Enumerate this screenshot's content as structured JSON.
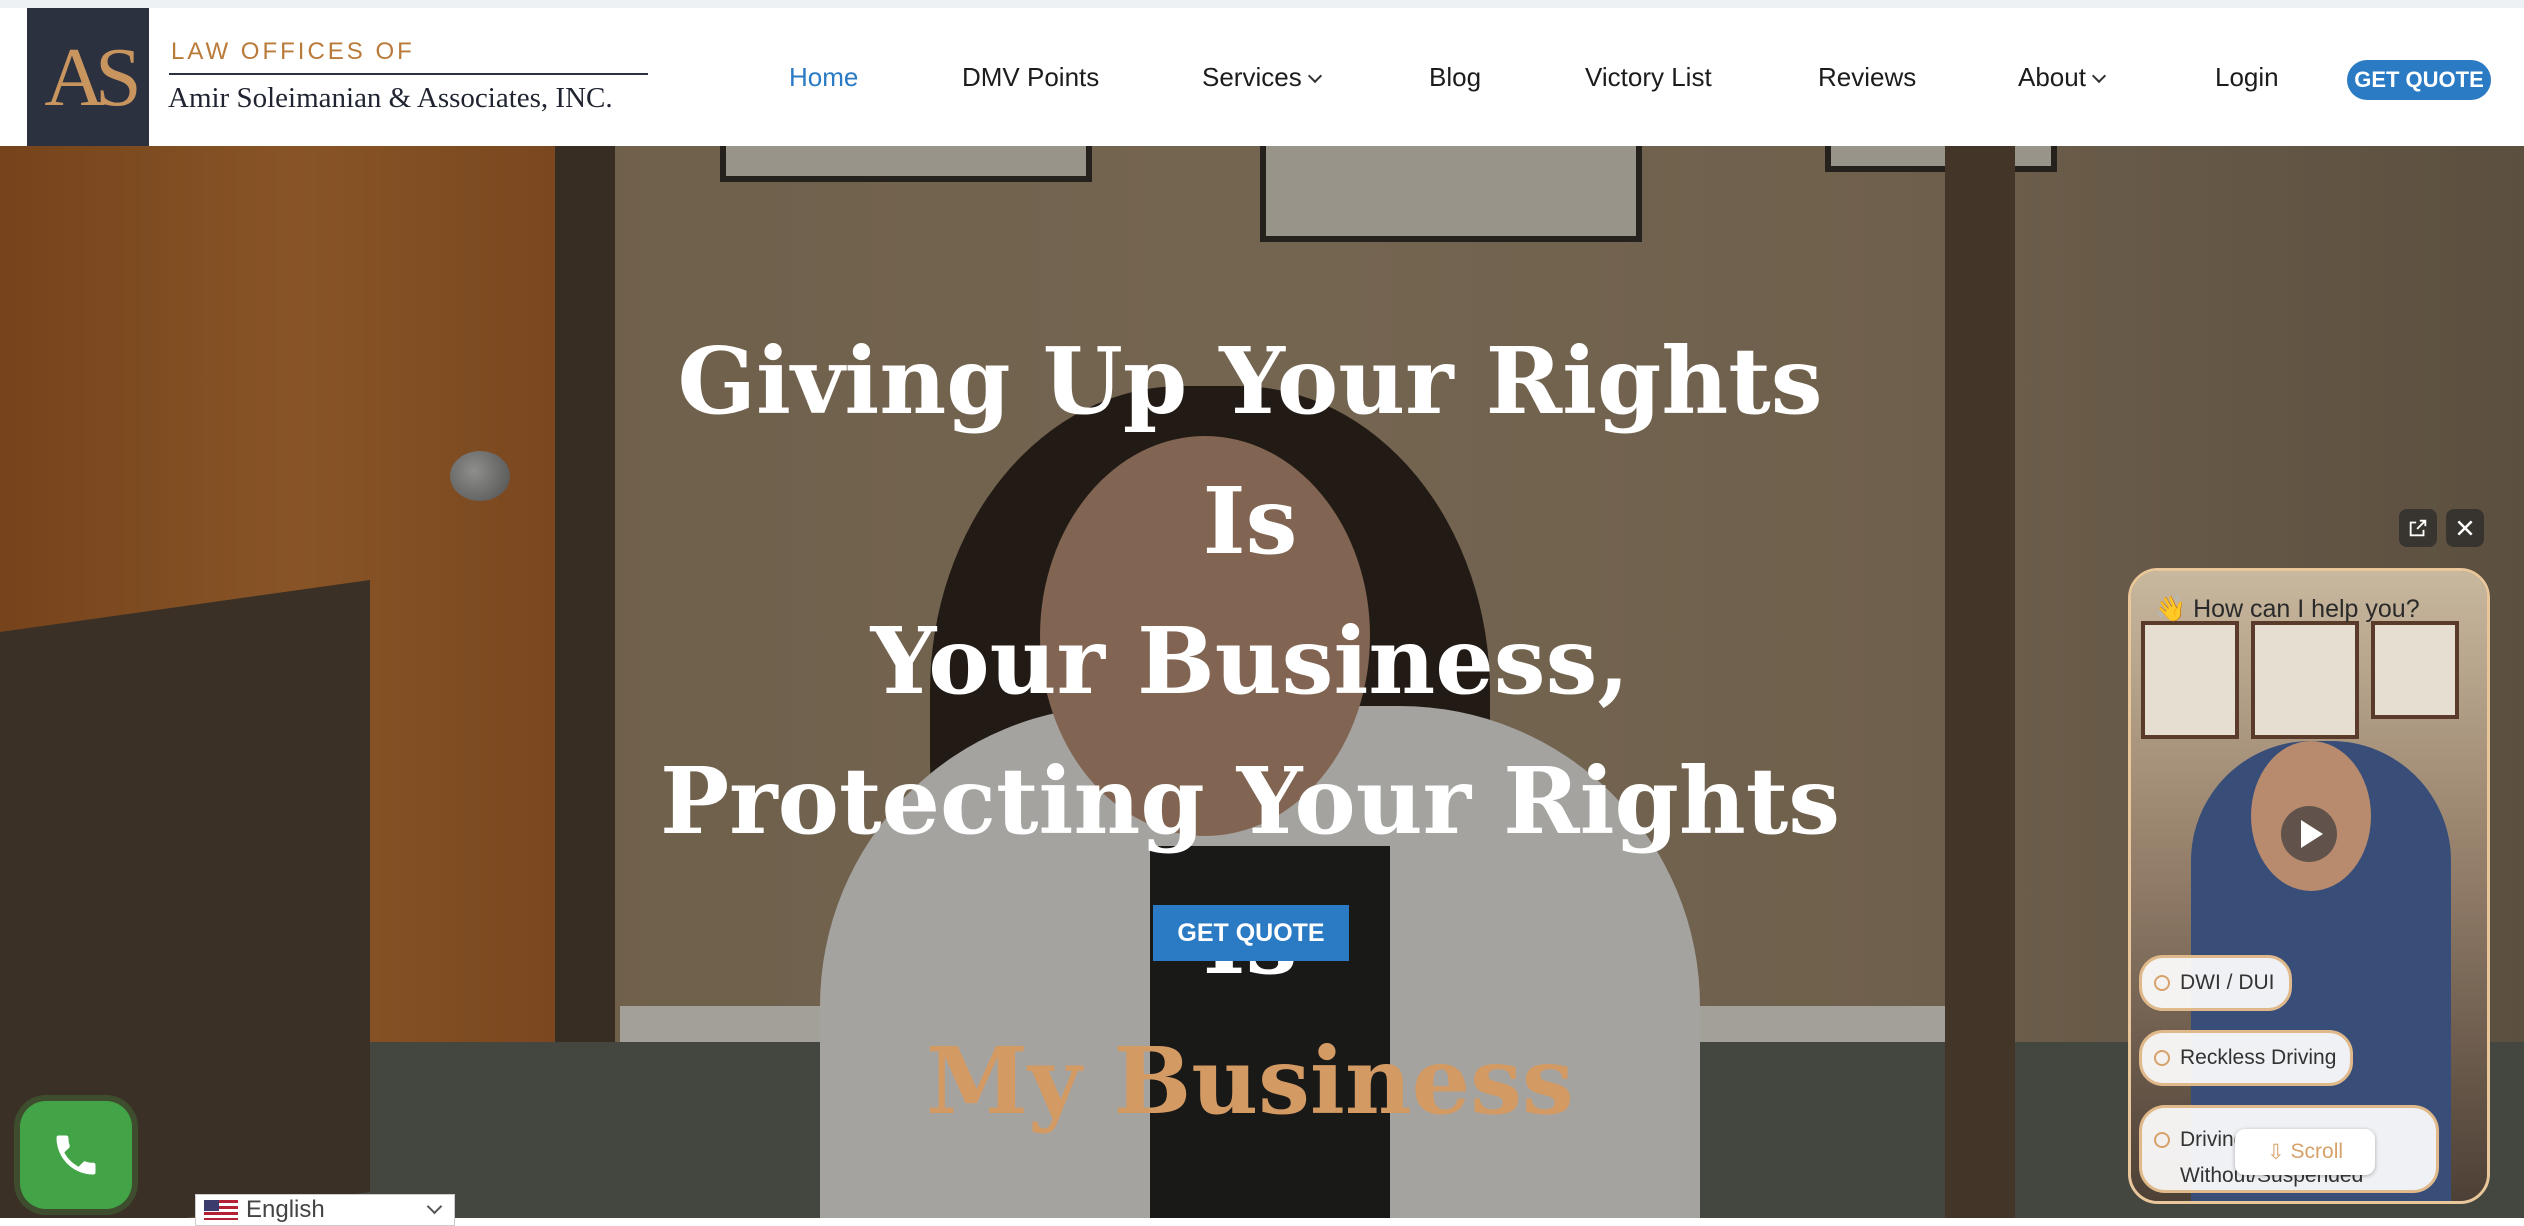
{
  "brand": {
    "logo_monogram": "AS",
    "firm_prefix": "LAW OFFICES OF",
    "firm_name": "Amir Soleimanian & Associates, INC."
  },
  "nav": {
    "items": [
      {
        "label": "Home",
        "active": true
      },
      {
        "label": "DMV Points"
      },
      {
        "label": "Services",
        "dropdown": true
      },
      {
        "label": "Blog"
      },
      {
        "label": "Victory List"
      },
      {
        "label": "Reviews"
      },
      {
        "label": "About",
        "dropdown": true
      },
      {
        "label": "Login"
      }
    ],
    "cta_label": "GET QUOTE"
  },
  "hero": {
    "line1": "Giving Up Your Rights Is",
    "line2": "Your Business,",
    "line3": "Protecting Your Rights Is",
    "line4_accent": "My Business",
    "cta_label": "GET QUOTE"
  },
  "language": {
    "selected": "English"
  },
  "video_widget": {
    "greeting": "👋 How can I help you?",
    "options": [
      "DWI / DUI",
      "Reckless Driving",
      "Driving Without/Suspended License"
    ],
    "scroll_label": "Scroll"
  },
  "icons": {
    "phone": "phone-icon",
    "open_external": "external-link-icon",
    "close": "close-icon",
    "play": "play-icon",
    "flag": "us-flag-icon"
  },
  "colors": {
    "primary_blue": "#2b7bc4",
    "accent_gold": "#d49a63",
    "logo_navy": "#2c3140",
    "phone_green": "#43a447"
  }
}
